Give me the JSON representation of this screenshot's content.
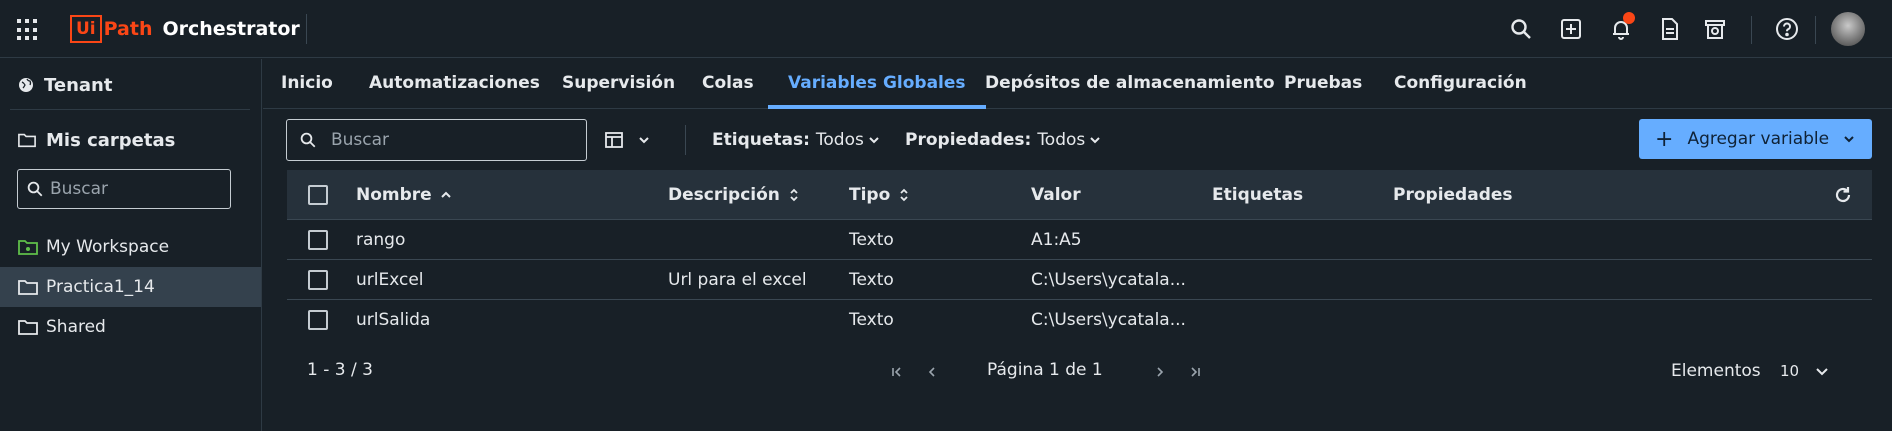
{
  "header": {
    "logo_ui": "Ui",
    "logo_path": "Path",
    "product": "Orchestrator",
    "icons": [
      "apps-grid-icon",
      "search-icon",
      "add-square-icon",
      "bell-icon",
      "document-icon",
      "store-icon",
      "help-icon"
    ]
  },
  "sidebar": {
    "tenant": "Tenant",
    "folders_title": "Mis carpetas",
    "search_placeholder": "Buscar",
    "items": [
      {
        "label": "My Workspace",
        "icon": "workspace-folder-icon"
      },
      {
        "label": "Practica1_14",
        "icon": "folder-icon",
        "active": true
      },
      {
        "label": "Shared",
        "icon": "folder-icon"
      }
    ]
  },
  "tabs": [
    "Inicio",
    "Automatizaciones",
    "Supervisión",
    "Colas",
    "Variables Globales",
    "Depósitos de almacenamiento",
    "Pruebas",
    "Configuración"
  ],
  "active_tab": "Variables Globales",
  "toolbar": {
    "search_placeholder": "Buscar",
    "filter_tags_label": "Etiquetas:",
    "filter_tags_value": "Todos",
    "filter_props_label": "Propiedades:",
    "filter_props_value": "Todos",
    "add_label": "Agregar variable"
  },
  "table": {
    "columns": [
      "Nombre",
      "Descripción",
      "Tipo",
      "Valor",
      "Etiquetas",
      "Propiedades"
    ],
    "rows": [
      {
        "nombre": "rango",
        "descripcion": "",
        "tipo": "Texto",
        "valor": "A1:A5",
        "etiquetas": "",
        "propiedades": ""
      },
      {
        "nombre": "urlExcel",
        "descripcion": "Url para el excel",
        "tipo": "Texto",
        "valor": "C:\\Users\\ycatala...",
        "etiquetas": "",
        "propiedades": ""
      },
      {
        "nombre": "urlSalida",
        "descripcion": "",
        "tipo": "Texto",
        "valor": "C:\\Users\\ycatala...",
        "etiquetas": "",
        "propiedades": ""
      }
    ]
  },
  "pager": {
    "count": "1 - 3 / 3",
    "page_label": "Página 1 de 1",
    "items_label": "Elementos",
    "page_size": "10"
  },
  "colors": {
    "background": "#182027",
    "accent": "#66adff",
    "brand": "#fa4616",
    "header_row": "#26313b",
    "active_item": "#34414d"
  }
}
